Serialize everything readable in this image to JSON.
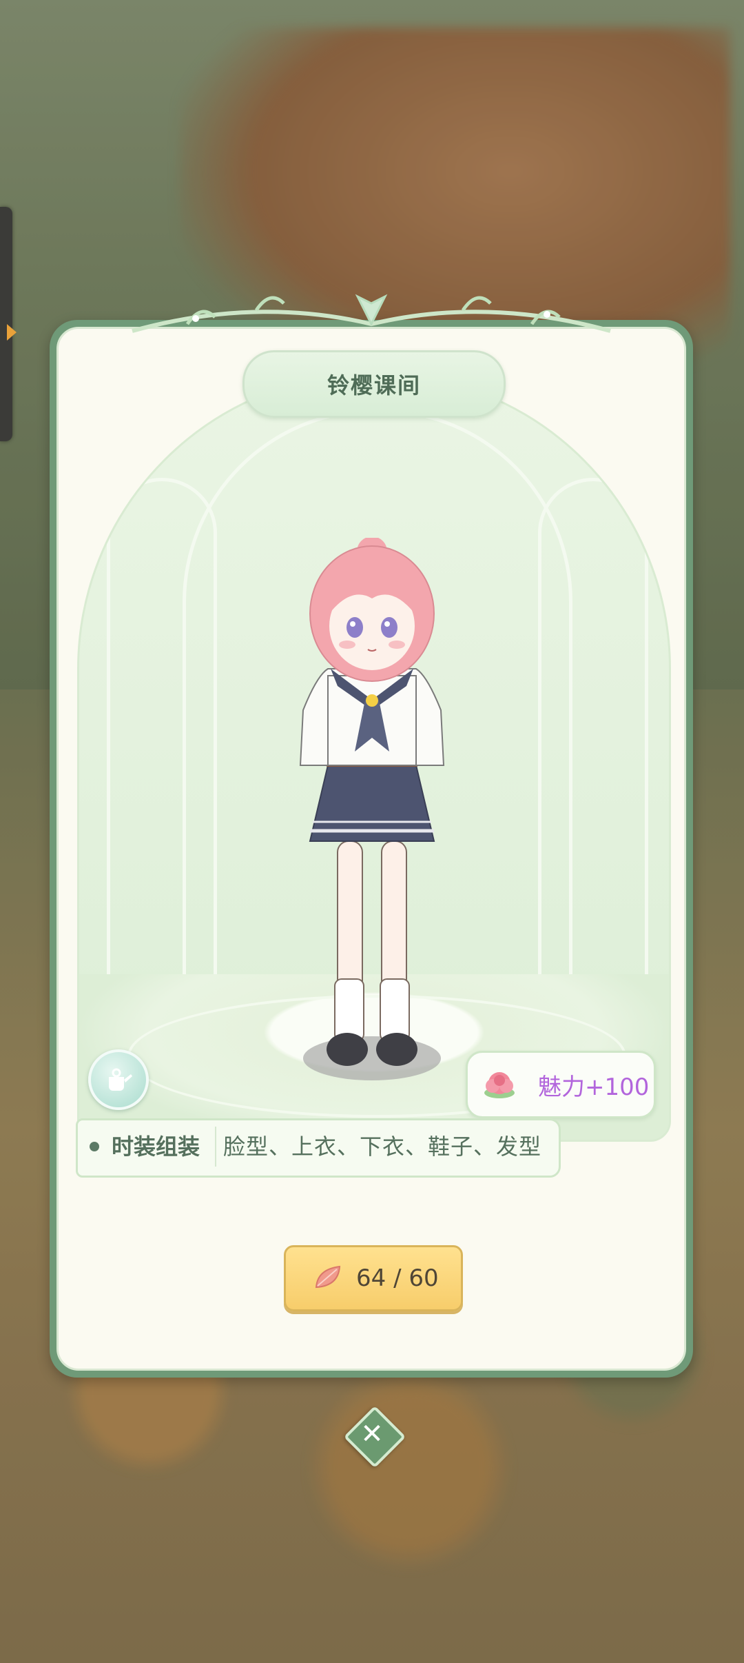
{
  "dialog": {
    "title": "铃樱课间",
    "charm_label": "魅力+100",
    "parts_label": "时装组装",
    "parts_value": "脸型、上衣、下衣、鞋子、发型",
    "cost_label": "64 / 60",
    "close_symbol": "✕"
  },
  "icons": {
    "wardrobe_button": "watering-can-icon",
    "charm": "flower-icon",
    "cost": "petal-icon",
    "side_tab": "chevron-right-icon"
  },
  "colors": {
    "frame": "#6f9a78",
    "panel": "#fbfaf1",
    "charm_text": "#b265dc",
    "cost_button": "#f7cd6b"
  }
}
